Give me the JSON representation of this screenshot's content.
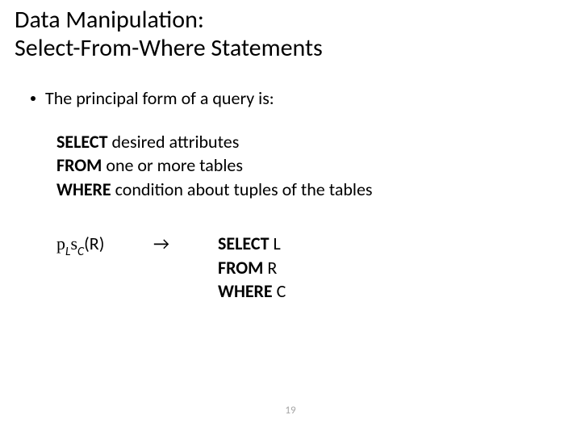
{
  "title": {
    "line1": "Data Manipulation:",
    "line2": "Select-From-Where Statements"
  },
  "bullet1": "The principal form of a query is:",
  "query": {
    "select_kw": "SELECT",
    "select_rest": " desired attributes",
    "from_kw": "FROM",
    "from_rest": " one or more tables",
    "where_kw": "WHERE",
    "where_rest": " condition about tuples of the tables"
  },
  "algebra": {
    "pi": "p",
    "subL": "L",
    "sigma": "s",
    "subC": "C",
    "rel": "(R)",
    "arrow": "→"
  },
  "sql": {
    "select_kw": "SELECT",
    "select_arg": " L",
    "from_kw": "FROM",
    "from_arg": " R",
    "where_kw": "WHERE",
    "where_arg": " C"
  },
  "page": "19"
}
